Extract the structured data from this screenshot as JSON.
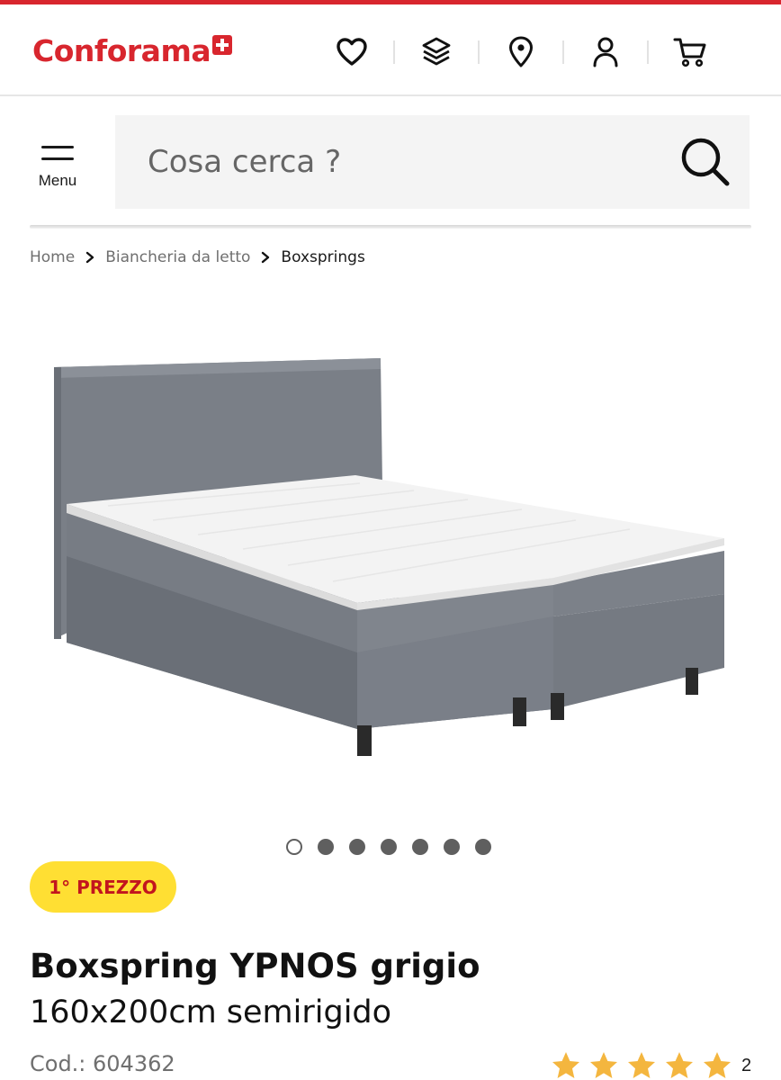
{
  "brand": {
    "name": "Conforama",
    "accent_color": "#d8262e"
  },
  "header": {
    "icons": [
      {
        "name": "wishlist",
        "icon": "heart-icon"
      },
      {
        "name": "compare",
        "icon": "layers-icon"
      },
      {
        "name": "stores",
        "icon": "location-pin-icon"
      },
      {
        "name": "account",
        "icon": "user-icon"
      },
      {
        "name": "cart",
        "icon": "cart-icon"
      }
    ]
  },
  "menu": {
    "label": "Menu"
  },
  "search": {
    "placeholder": "Cosa cerca ?"
  },
  "breadcrumb": {
    "items": [
      "Home",
      "Biancheria da letto"
    ],
    "current": "Boxsprings"
  },
  "gallery": {
    "image_count": 7,
    "active_index": 0
  },
  "product": {
    "badge": "1° PREZZO",
    "badge_color": "#ffdf33",
    "title": "Boxspring YPNOS grigio",
    "subtitle": "160x200cm semirigido",
    "code": "Cod.: 604362",
    "rating": {
      "stars": 5,
      "max": 5,
      "count": "2",
      "star_color": "#f4b63f"
    }
  }
}
